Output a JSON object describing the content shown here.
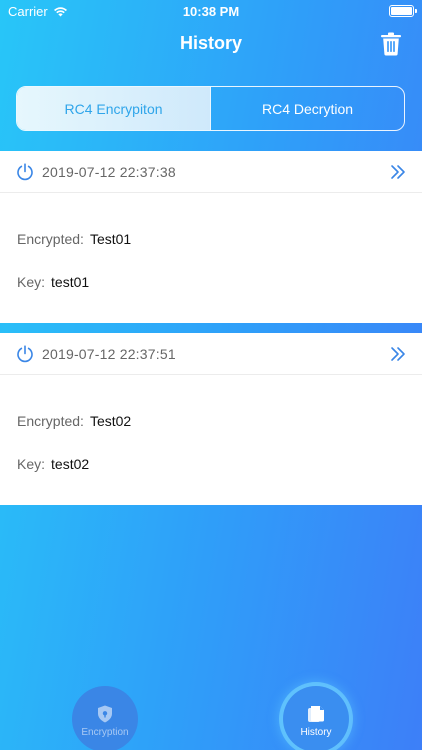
{
  "status_bar": {
    "carrier": "Carrier",
    "time": "10:38 PM"
  },
  "nav": {
    "title": "History",
    "trash_icon": "trash-icon"
  },
  "segment": {
    "items": [
      {
        "label": "RC4 Encrypiton",
        "active": true
      },
      {
        "label": "RC4 Decrytion",
        "active": false
      }
    ]
  },
  "records": [
    {
      "date": "2019-07-12 22:37:38",
      "encrypted_label": "Encrypted:",
      "encrypted_value": "Test01",
      "key_label": "Key:",
      "key_value": "test01"
    },
    {
      "date": "2019-07-12 22:37:51",
      "encrypted_label": "Encrypted:",
      "encrypted_value": "Test02",
      "key_label": "Key:",
      "key_value": "test02"
    }
  ],
  "tabs": [
    {
      "label": "Encryption",
      "icon": "shield-icon",
      "active": false
    },
    {
      "label": "History",
      "icon": "history-icon",
      "active": true
    }
  ],
  "colors": {
    "accent": "#2fa5ea",
    "gradient_start": "#28c6f8",
    "gradient_end": "#3d7ff8"
  }
}
